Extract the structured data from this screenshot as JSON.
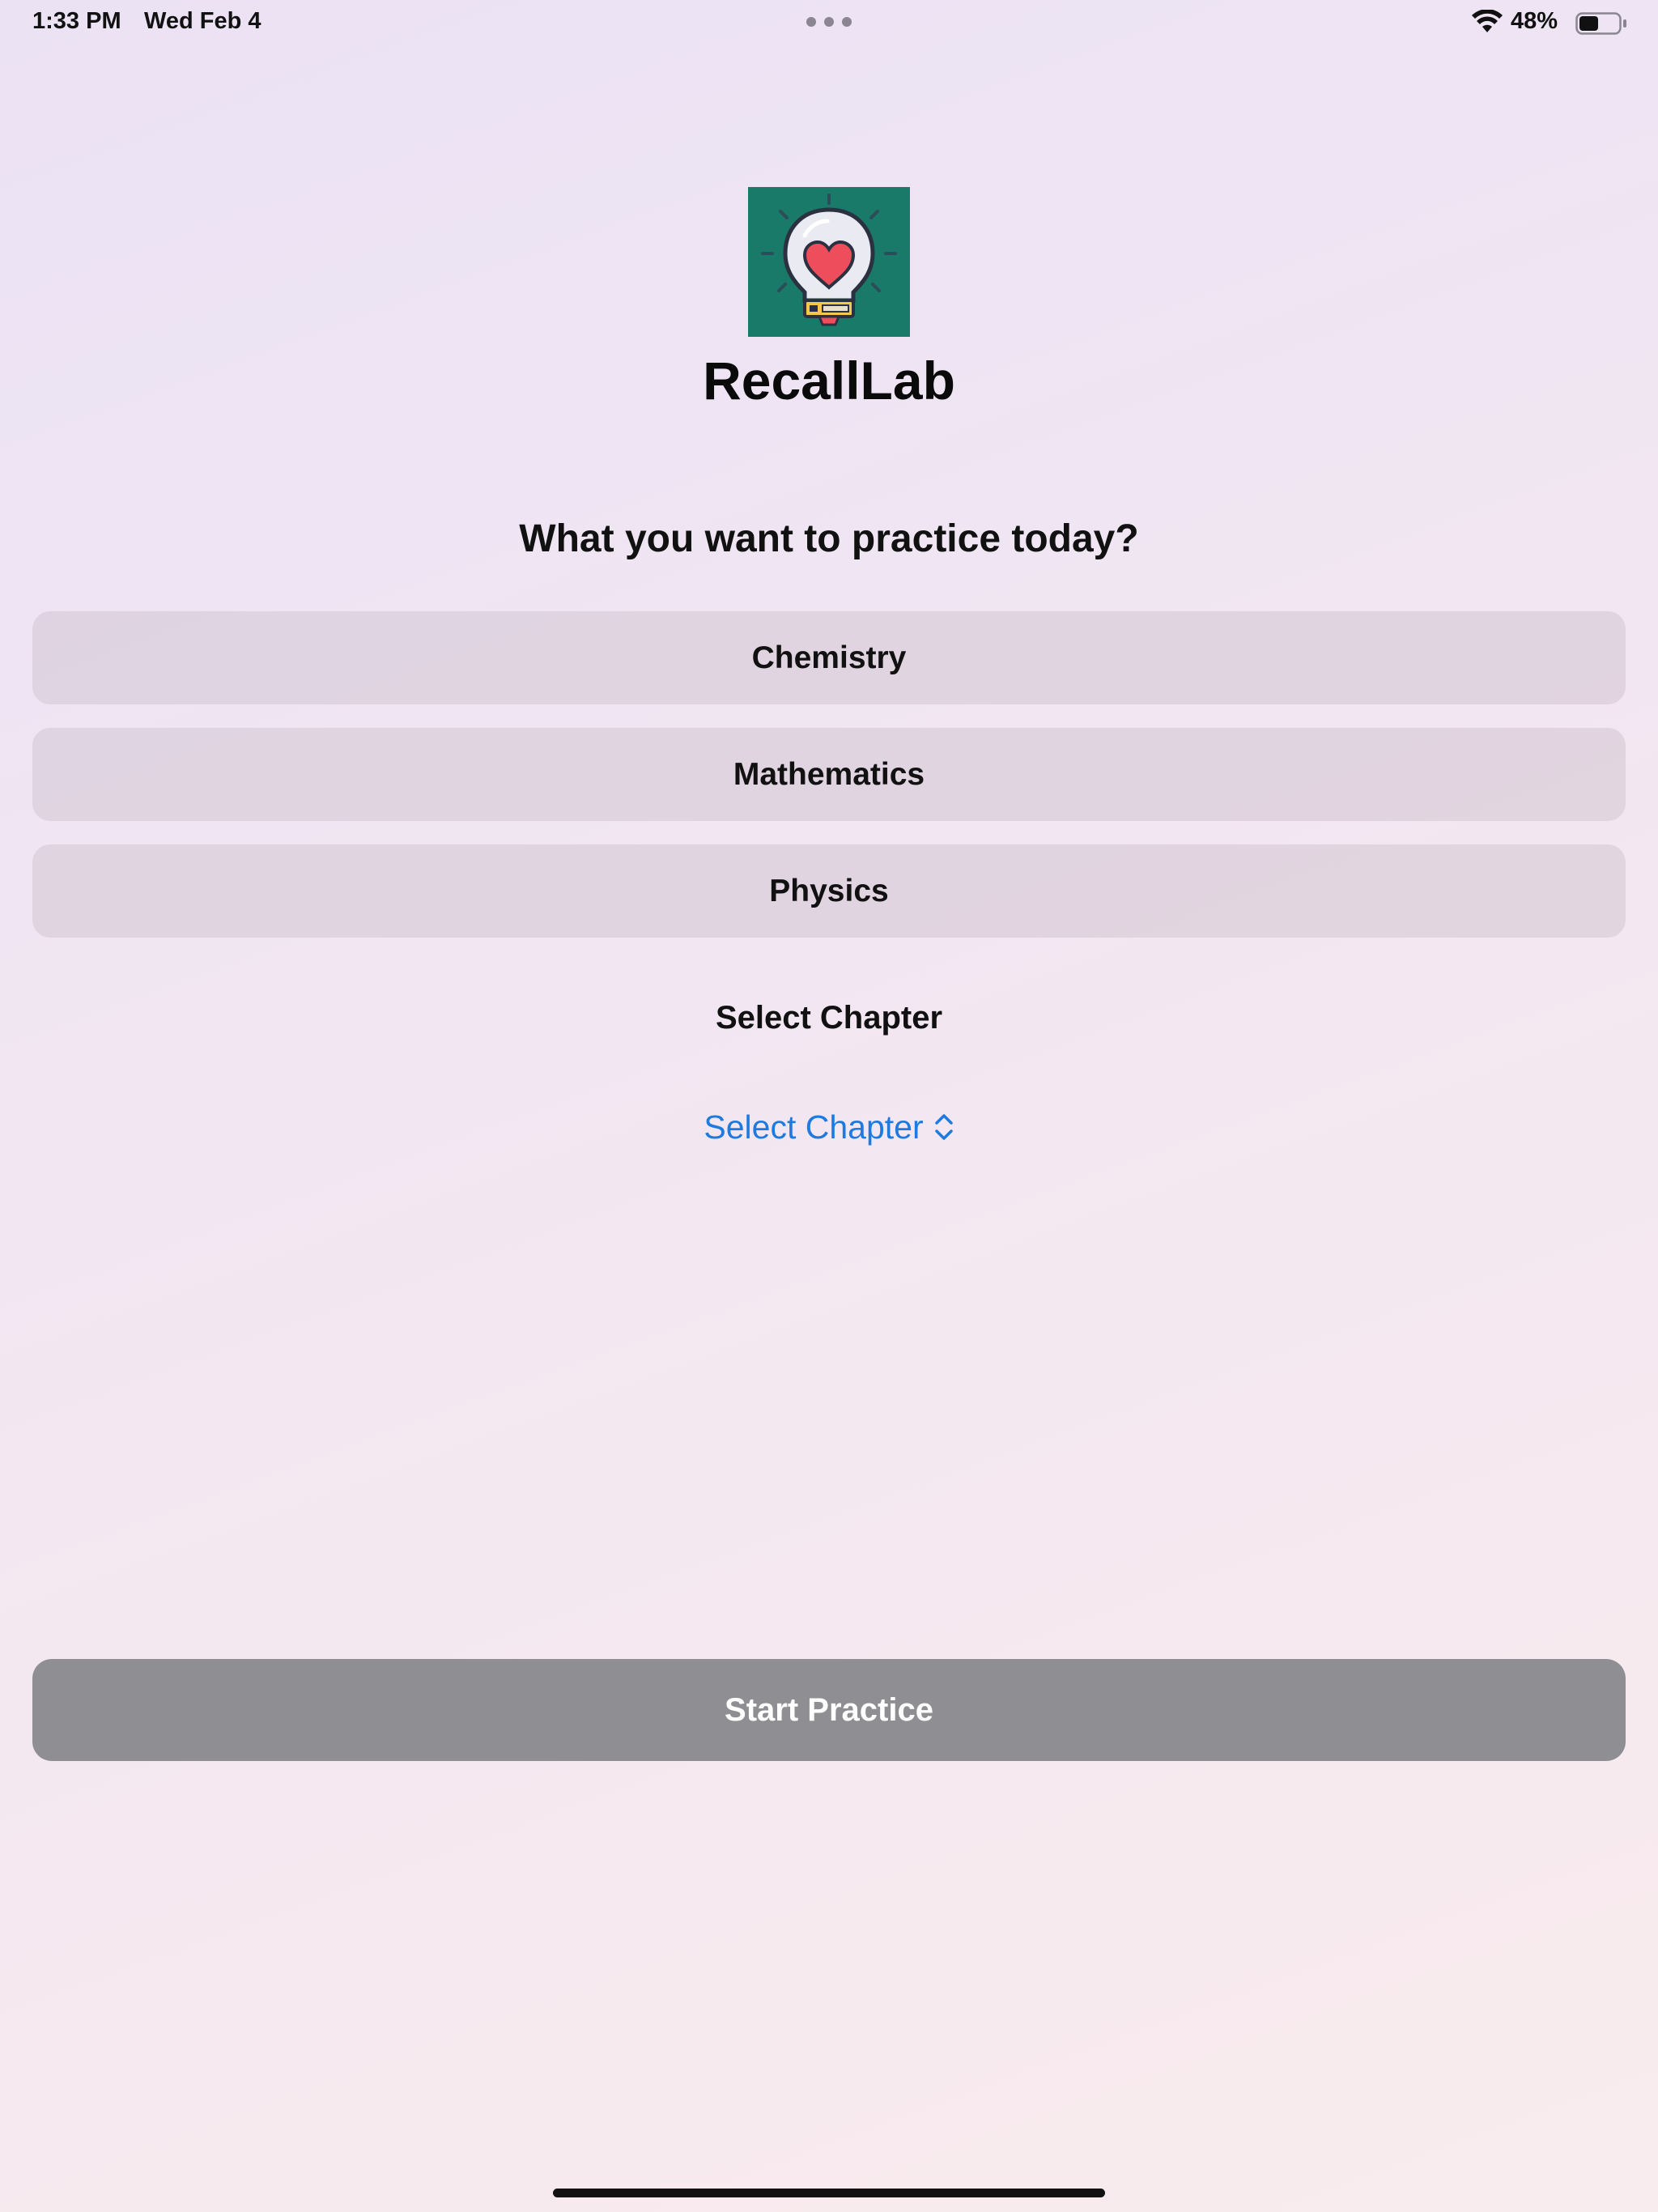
{
  "status_bar": {
    "time": "1:33 PM",
    "date": "Wed Feb 4",
    "battery_percent": "48%",
    "battery_level": 0.48,
    "icons": [
      "wifi-icon",
      "battery-icon"
    ]
  },
  "header": {
    "logo_icon": "lightbulb-heart-icon",
    "app_title": "RecallLab"
  },
  "prompt": {
    "heading": "What you want to practice today?"
  },
  "subjects": [
    {
      "label": "Chemistry"
    },
    {
      "label": "Mathematics"
    },
    {
      "label": "Physics"
    }
  ],
  "chapter": {
    "heading": "Select Chapter",
    "picker_value": "Select Chapter",
    "picker_icon": "chevron-updown-icon"
  },
  "actions": {
    "start_label": "Start Practice"
  },
  "colors": {
    "accent": "#1f7ae0",
    "start_button_bg": "#8f8f93",
    "logo_bg": "#1a7a6a",
    "subject_button_bg": "#e0d4e1"
  }
}
